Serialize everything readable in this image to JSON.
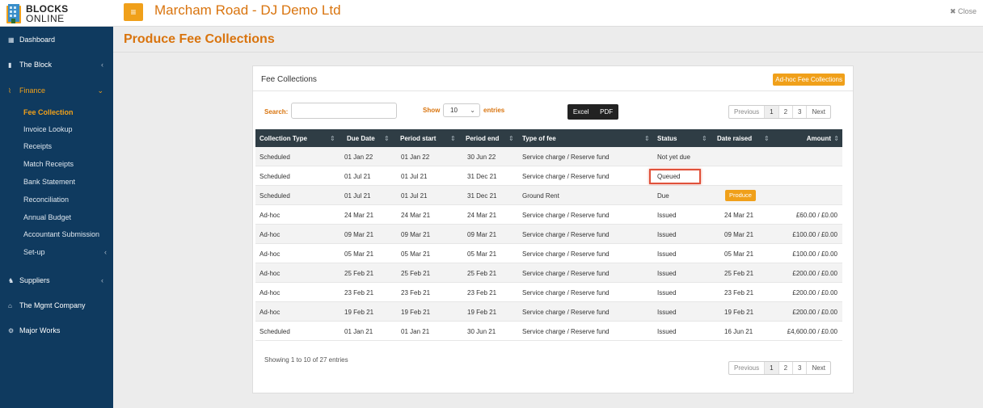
{
  "brand": {
    "line1": "BLOCKS",
    "line2": "ONLINE"
  },
  "header": {
    "menu_icon": "≡",
    "title": "Marcham Road - DJ Demo Ltd",
    "close_label": "✖ Close"
  },
  "sidebar": {
    "items": [
      {
        "icon": "▦",
        "label": "Dashboard"
      },
      {
        "icon": "▮",
        "label": "The Block",
        "chevron": "‹"
      },
      {
        "icon": "⌇",
        "label": "Finance",
        "chevron": "⌄"
      },
      {
        "icon": "♞",
        "label": "Suppliers",
        "chevron": "‹"
      },
      {
        "icon": "⌂",
        "label": "The Mgmt Company"
      },
      {
        "icon": "⚙",
        "label": "Major Works"
      }
    ],
    "finance_sub": [
      "Fee Collection",
      "Invoice Lookup",
      "Receipts",
      "Match Receipts",
      "Bank Statement",
      "Reconciliation",
      "Annual Budget",
      "Accountant Submission",
      "Set-up"
    ],
    "setup_chevron": "‹"
  },
  "page": {
    "heading": "Produce Fee Collections"
  },
  "panel": {
    "title": "Fee Collections",
    "adhoc_button": "Ad-hoc Fee Collections",
    "search_label": "Search:",
    "search_value": "",
    "show_label": "Show",
    "show_value": "10",
    "entries_label": "entries",
    "export": {
      "excel": "Excel",
      "pdf": "PDF"
    },
    "pager": {
      "previous": "Previous",
      "pages": [
        "1",
        "2",
        "3"
      ],
      "next": "Next"
    },
    "info": "Showing 1 to 10 of 27 entries"
  },
  "table": {
    "headers": [
      "Collection Type",
      "Due Date",
      "Period start",
      "Period end",
      "Type of fee",
      "Status",
      "Date raised",
      "Amount"
    ],
    "sort_icon": "⇕",
    "rows": [
      [
        "Scheduled",
        "01 Jan 22",
        "01 Jan 22",
        "30 Jun 22",
        "Service charge / Reserve fund",
        "Not yet due",
        "",
        ""
      ],
      [
        "Scheduled",
        "01 Jul 21",
        "01 Jul 21",
        "31 Dec 21",
        "Service charge / Reserve fund",
        "Queued",
        "",
        ""
      ],
      [
        "Scheduled",
        "01 Jul 21",
        "01 Jul 21",
        "31 Dec 21",
        "Ground Rent",
        "Due",
        "Produce",
        ""
      ],
      [
        "Ad-hoc",
        "24 Mar 21",
        "24 Mar 21",
        "24 Mar 21",
        "Service charge / Reserve fund",
        "Issued",
        "24 Mar 21",
        "£60.00 / £0.00"
      ],
      [
        "Ad-hoc",
        "09 Mar 21",
        "09 Mar 21",
        "09 Mar 21",
        "Service charge / Reserve fund",
        "Issued",
        "09 Mar 21",
        "£100.00 / £0.00"
      ],
      [
        "Ad-hoc",
        "05 Mar 21",
        "05 Mar 21",
        "05 Mar 21",
        "Service charge / Reserve fund",
        "Issued",
        "05 Mar 21",
        "£100.00 / £0.00"
      ],
      [
        "Ad-hoc",
        "25 Feb 21",
        "25 Feb 21",
        "25 Feb 21",
        "Service charge / Reserve fund",
        "Issued",
        "25 Feb 21",
        "£200.00 / £0.00"
      ],
      [
        "Ad-hoc",
        "23 Feb 21",
        "23 Feb 21",
        "23 Feb 21",
        "Service charge / Reserve fund",
        "Issued",
        "23 Feb 21",
        "£200.00 / £0.00"
      ],
      [
        "Ad-hoc",
        "19 Feb 21",
        "19 Feb 21",
        "19 Feb 21",
        "Service charge / Reserve fund",
        "Issued",
        "19 Feb 21",
        "£200.00 / £0.00"
      ],
      [
        "Scheduled",
        "01 Jan 21",
        "01 Jan 21",
        "30 Jun 21",
        "Service charge / Reserve fund",
        "Issued",
        "16 Jun 21",
        "£4,600.00 / £0.00"
      ]
    ]
  },
  "colors": {
    "accent": "#d9740e",
    "button": "#f0a01a",
    "sidebar": "#0f3a5f",
    "table_header": "#2f3d45",
    "highlight": "#e0513a"
  }
}
